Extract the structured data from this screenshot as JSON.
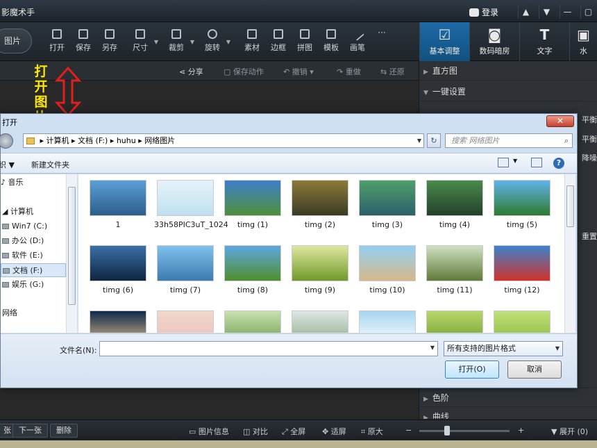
{
  "app": {
    "title": "影魔术手",
    "login": "登录"
  },
  "window_buttons": [
    "▲",
    "▼",
    "—",
    "▢"
  ],
  "toolbar": {
    "open_picture": "图片",
    "tools": [
      "打开",
      "保存",
      "另存",
      "尺寸",
      "裁剪",
      "旋转",
      "素材",
      "边框",
      "拼图",
      "模板",
      "画笔"
    ],
    "more": "···",
    "right_tabs": [
      {
        "label": "基本调整",
        "glyph": "☑"
      },
      {
        "label": "数码暗房",
        "glyph": "◙"
      },
      {
        "label": "文字",
        "glyph": "T"
      },
      {
        "label": "水",
        "glyph": "▣"
      }
    ]
  },
  "subbar": {
    "share": "分享",
    "save_action": "保存动作",
    "undo": "撤销",
    "redo": "重做",
    "restore": "还原"
  },
  "annotation": {
    "text": "打开图片",
    "chars": [
      "打",
      "开",
      "图",
      "片"
    ]
  },
  "right_panel": {
    "histogram": "直方图",
    "one_click": "一键设置",
    "side_labels": [
      "平衡",
      "平衡",
      "降噪",
      "重置"
    ],
    "color_scale": "色阶",
    "curve": "曲线"
  },
  "dialog": {
    "title": "打开",
    "close": "✕",
    "address": [
      "计算机",
      "文档 (F:)",
      "huhu",
      "网络图片"
    ],
    "search_placeholder": "搜索 网络图片",
    "organize": "组织 ▼",
    "new_folder": "新建文件夹",
    "nav": [
      {
        "label": "音乐",
        "selected": false
      },
      {
        "label": "计算机",
        "selected": false
      },
      {
        "label": "Win7 (C:)",
        "selected": false
      },
      {
        "label": "办公 (D:)",
        "selected": false
      },
      {
        "label": "软件 (E:)",
        "selected": false
      },
      {
        "label": "文档 (F:)",
        "selected": true
      },
      {
        "label": "娱乐 (G:)",
        "selected": false
      },
      {
        "label": "网络",
        "selected": false
      }
    ],
    "files": [
      {
        "name": "1",
        "c1": "#5a9fd6",
        "c2": "#2e5e8a"
      },
      {
        "name": "33h58PIC3uT_1024",
        "c1": "#e6f3fa",
        "c2": "#bfe0f0"
      },
      {
        "name": "timg (1)",
        "c1": "#3d7fc9",
        "c2": "#4f8f3a"
      },
      {
        "name": "timg (2)",
        "c1": "#8c7a3a",
        "c2": "#3b3b25"
      },
      {
        "name": "timg (3)",
        "c1": "#4f9f6a",
        "c2": "#2d5f6a"
      },
      {
        "name": "timg (4)",
        "c1": "#4b8a4b",
        "c2": "#23402a"
      },
      {
        "name": "timg (5)",
        "c1": "#5fb3e8",
        "c2": "#2f7a2f"
      },
      {
        "name": "timg (6)",
        "c1": "#3a6fa8",
        "c2": "#0f2540"
      },
      {
        "name": "timg (7)",
        "c1": "#7fc1ec",
        "c2": "#3b7bb0"
      },
      {
        "name": "timg (8)",
        "c1": "#5da7e0",
        "c2": "#4f8e2c"
      },
      {
        "name": "timg (9)",
        "c1": "#dfe6a0",
        "c2": "#6f9a2a"
      },
      {
        "name": "timg (10)",
        "c1": "#93d0f2",
        "c2": "#d6b88a"
      },
      {
        "name": "timg (11)",
        "c1": "#cfe0c0",
        "c2": "#607a3a"
      },
      {
        "name": "timg (12)",
        "c1": "#3d82cc",
        "c2": "#d0322a"
      },
      {
        "name": "",
        "c1": "#0e2a4a",
        "c2": "#e6c08a"
      },
      {
        "name": "",
        "c1": "#f2d6cc",
        "c2": "#e8c0b8"
      },
      {
        "name": "",
        "c1": "#c8e0b0",
        "c2": "#6a9a4a"
      },
      {
        "name": "",
        "c1": "#dfe6e8",
        "c2": "#88a878"
      },
      {
        "name": "",
        "c1": "#a8d4f0",
        "c2": "#ffffff"
      },
      {
        "name": "",
        "c1": "#b8d66a",
        "c2": "#6f9a2a"
      },
      {
        "name": "",
        "c1": "#bfe07a",
        "c2": "#8ab53a"
      }
    ],
    "filename_label": "文件名(N):",
    "filename_value": "",
    "filetype": "所有支持的图片格式",
    "open_button": "打开(O)",
    "cancel_button": "取消"
  },
  "statusbar": {
    "prev": "张",
    "next": "下一张",
    "delete": "删除",
    "info": "图片信息",
    "compare": "对比",
    "fullscreen": "全屏",
    "fit": "适屏",
    "original": "原大",
    "minus": "−",
    "plus": "+",
    "expand": "▼ 展开 (0)"
  }
}
